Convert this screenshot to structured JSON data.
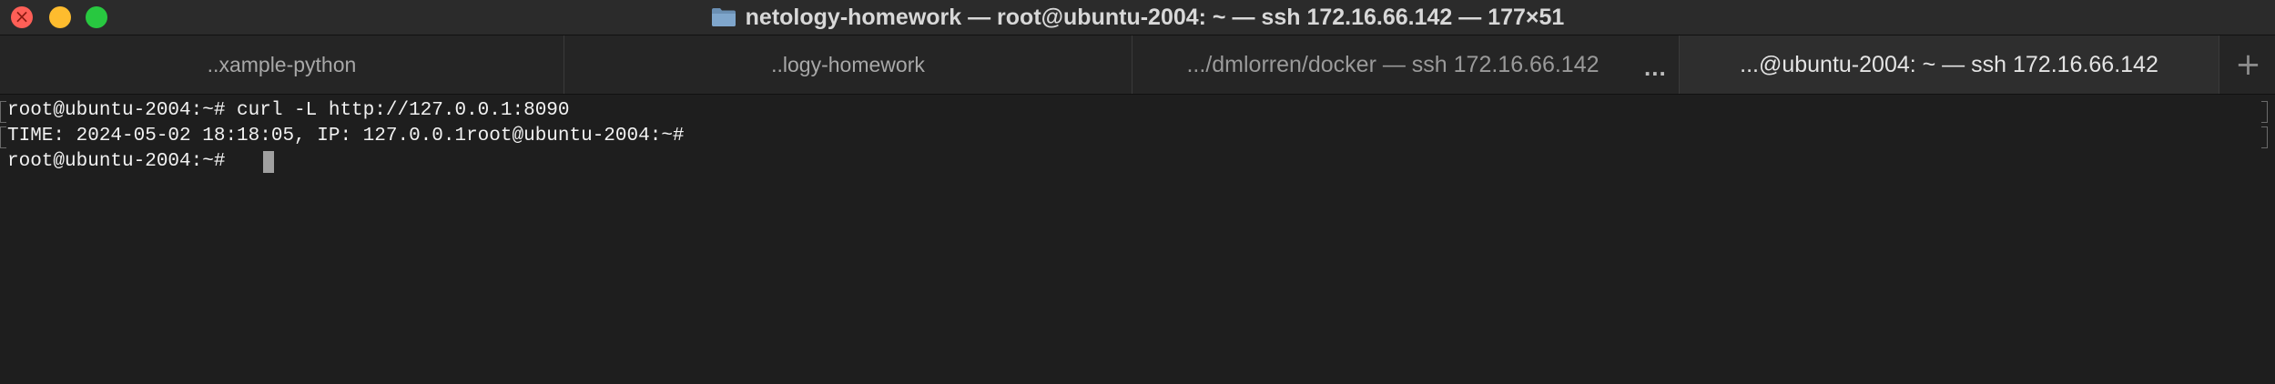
{
  "window": {
    "title": "netology-homework — root@ubuntu-2004: ~ — ssh 172.16.66.142 — 177×51",
    "folder_icon": "folder-icon",
    "colors": {
      "close": "#ff5f57",
      "minimize": "#febc2e",
      "maximize": "#28c840",
      "background": "#1e1e1e"
    }
  },
  "tabs": [
    {
      "label": "..xample-python",
      "active": false
    },
    {
      "label": "..logy-homework",
      "active": false
    },
    {
      "label": ".../dmlorren/docker — ssh 172.16.66.142",
      "active": false
    },
    {
      "label": "...@ubuntu-2004: ~ — ssh 172.16.66.142",
      "active": true
    }
  ],
  "tab_overflow": "...",
  "new_tab": "+",
  "terminal": {
    "lines": [
      "root@ubuntu-2004:~# curl -L http://127.0.0.1:8090",
      "TIME: 2024-05-02 18:18:05, IP: 127.0.0.1root@ubuntu-2004:~#",
      "root@ubuntu-2004:~# "
    ]
  }
}
